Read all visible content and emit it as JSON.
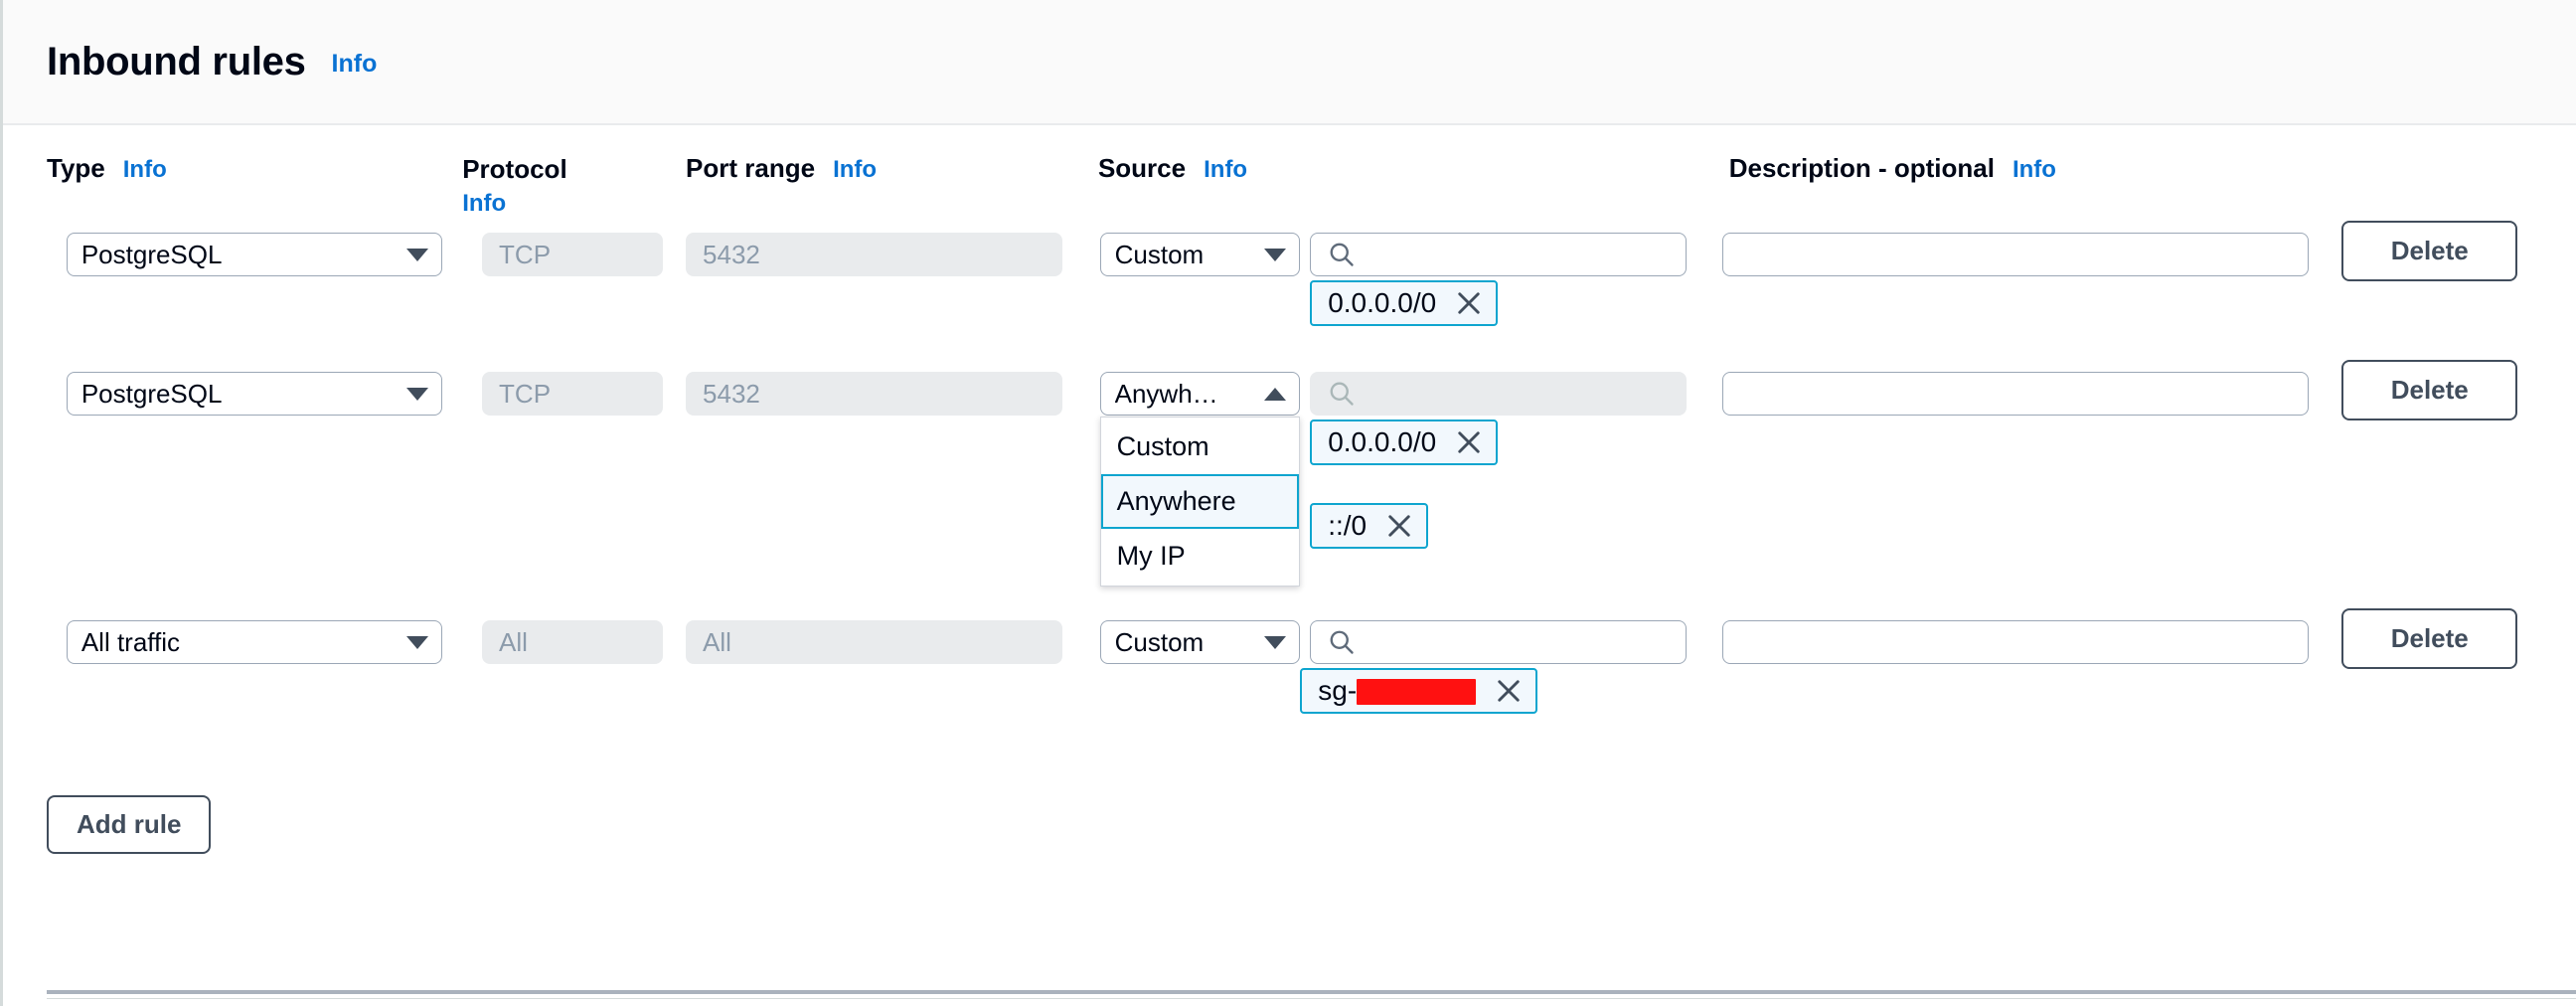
{
  "panel": {
    "title": "Inbound rules",
    "info_label": "Info"
  },
  "columns": {
    "type": "Type",
    "protocol": "Protocol",
    "port_range": "Port range",
    "source": "Source",
    "description": "Description - optional",
    "info_label": "Info"
  },
  "colors": {
    "link": "#0972d3",
    "chip_border": "#0ea5cf",
    "chip_fill": "#f2f8fd",
    "disabled_fill": "#e9ebed",
    "border": "#9ba7b6",
    "button_border": "#414d5c",
    "redaction": "#ff1111",
    "header_bg": "#fafafa"
  },
  "rules": [
    {
      "type": "PostgreSQL",
      "protocol": "TCP",
      "port_range": "5432",
      "source_type": "Custom",
      "source_search_value": "",
      "chips": [
        {
          "label": "0.0.0.0/0",
          "redacted": false
        }
      ],
      "description": "",
      "delete_label": "Delete",
      "dropdown_open": false,
      "search_disabled": false
    },
    {
      "type": "PostgreSQL",
      "protocol": "TCP",
      "port_range": "5432",
      "source_type": "Anywh…",
      "source_search_value": "",
      "chips": [
        {
          "label": "0.0.0.0/0",
          "redacted": false
        },
        {
          "label": "::/0",
          "redacted": false
        }
      ],
      "description": "",
      "delete_label": "Delete",
      "dropdown_open": true,
      "search_disabled": true,
      "dropdown_options": [
        {
          "label": "Custom",
          "selected": false
        },
        {
          "label": "Anywhere",
          "selected": true
        },
        {
          "label": "My IP",
          "selected": false
        }
      ]
    },
    {
      "type": "All traffic",
      "protocol": "All",
      "port_range": "All",
      "source_type": "Custom",
      "source_search_value": "",
      "chips": [
        {
          "label": "sg-",
          "redacted": true,
          "redacted_width": 120
        }
      ],
      "description": "",
      "delete_label": "Delete",
      "dropdown_open": false,
      "search_disabled": false
    }
  ],
  "actions": {
    "add_rule_label": "Add rule"
  },
  "icons": {
    "search": "search-icon",
    "close": "close-icon",
    "caret_down": "chevron-down-icon",
    "caret_up": "chevron-up-icon"
  }
}
